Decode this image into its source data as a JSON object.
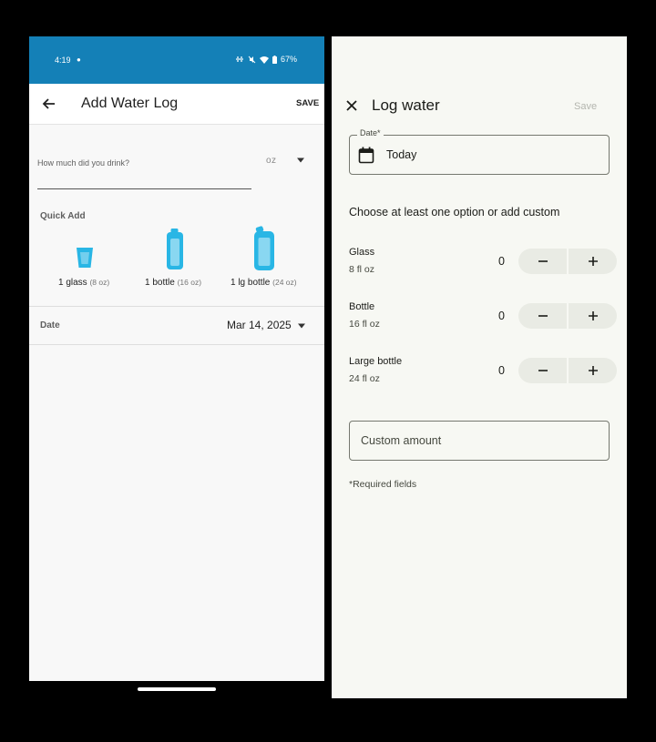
{
  "left": {
    "status": {
      "time": "4:19",
      "battery": "67%"
    },
    "header": {
      "title": "Add Water Log",
      "save_label": "SAVE"
    },
    "amount": {
      "prompt": "How much did you drink?",
      "unit": "oz"
    },
    "quick_add": {
      "label": "Quick Add",
      "items": [
        {
          "name": "1 glass",
          "size": "(8 oz)",
          "icon": "glass-icon"
        },
        {
          "name": "1 bottle",
          "size": "(16 oz)",
          "icon": "bottle-icon"
        },
        {
          "name": "1 lg bottle",
          "size": "(24 oz)",
          "icon": "large-bottle-icon"
        }
      ]
    },
    "date": {
      "label": "Date",
      "value": "Mar 14, 2025"
    }
  },
  "right": {
    "header": {
      "title": "Log water",
      "save_label": "Save"
    },
    "date_field": {
      "label": "Date*",
      "value": "Today"
    },
    "instruction": "Choose at least one option or add custom",
    "options": [
      {
        "name": "Glass",
        "size": "8 fl oz",
        "count": "0"
      },
      {
        "name": "Bottle",
        "size": "16 fl oz",
        "count": "0"
      },
      {
        "name": "Large bottle",
        "size": "24 fl oz",
        "count": "0"
      }
    ],
    "custom_placeholder": "Custom amount",
    "required_note": "*Required fields"
  },
  "colors": {
    "status_bar": "#1480b7",
    "water_icon": "#29b6e5",
    "right_background": "#f7f8f3"
  }
}
